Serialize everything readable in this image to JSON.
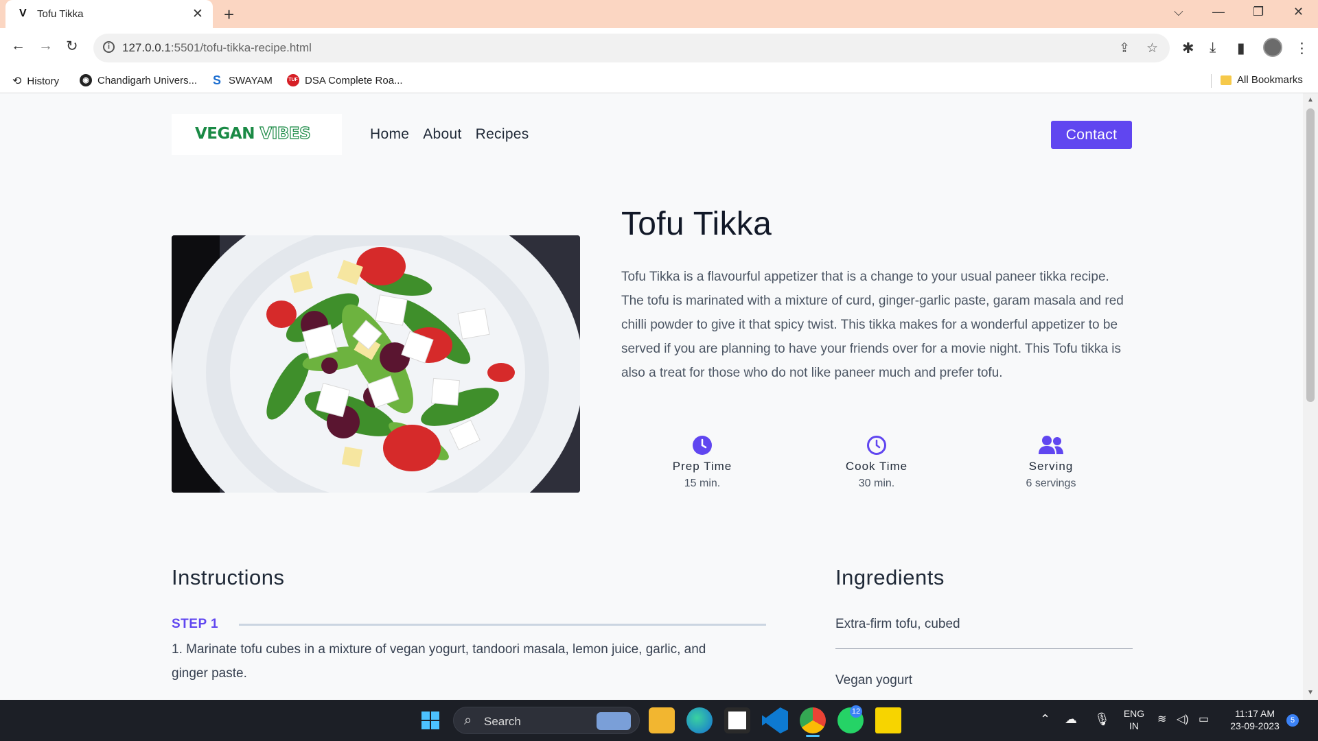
{
  "browser": {
    "tab_title": "Tofu Tikka",
    "tab_favicon": "V",
    "url_host": "127.0.0.1",
    "url_rest": ":5501/tofu-tikka-recipe.html",
    "bookmarks": [
      {
        "label": "History",
        "icon": "history-icon"
      },
      {
        "label": "Chandigarh Univers...",
        "icon": "globe-icon"
      },
      {
        "label": "SWAYAM",
        "icon": "swayam-icon"
      },
      {
        "label": "DSA Complete Roa...",
        "icon": "tuf-icon"
      }
    ],
    "all_bookmarks": "All Bookmarks"
  },
  "site": {
    "logo_part1": "VEGAN",
    "logo_part2": "VIBES",
    "nav": [
      "Home",
      "About",
      "Recipes"
    ],
    "contact": "Contact"
  },
  "recipe": {
    "title": "Tofu Tikka",
    "description": "Tofu Tikka is a flavourful appetizer that is a change to your usual paneer tikka recipe. The tofu is marinated with a mixture of curd, ginger-garlic paste, garam masala and red chilli powder to give it that spicy twist. This tikka makes for a wonderful appetizer to be served if you are planning to have your friends over for a movie night. This Tofu tikka is also a treat for those who do not like paneer much and prefer tofu.",
    "meta": [
      {
        "label": "Prep Time",
        "value": "15 min.",
        "icon": "clock-icon"
      },
      {
        "label": "Cook Time",
        "value": "30 min.",
        "icon": "clock-outline-icon"
      },
      {
        "label": "Serving",
        "value": "6 servings",
        "icon": "users-icon"
      }
    ],
    "accent": "#6046f0"
  },
  "instructions": {
    "heading": "Instructions",
    "steps": [
      {
        "label": "STEP 1",
        "text": "1. Marinate tofu cubes in a mixture of vegan yogurt, tandoori masala, lemon juice, garlic, and ginger paste."
      }
    ]
  },
  "ingredients": {
    "heading": "Ingredients",
    "items": [
      "Extra-firm tofu, cubed",
      "Vegan yogurt"
    ]
  },
  "taskbar": {
    "search": "Search",
    "whatsapp_badge": "12",
    "lang_line1": "ENG",
    "lang_line2": "IN",
    "time": "11:17 AM",
    "date": "23-09-2023",
    "notif_badge": "5"
  }
}
